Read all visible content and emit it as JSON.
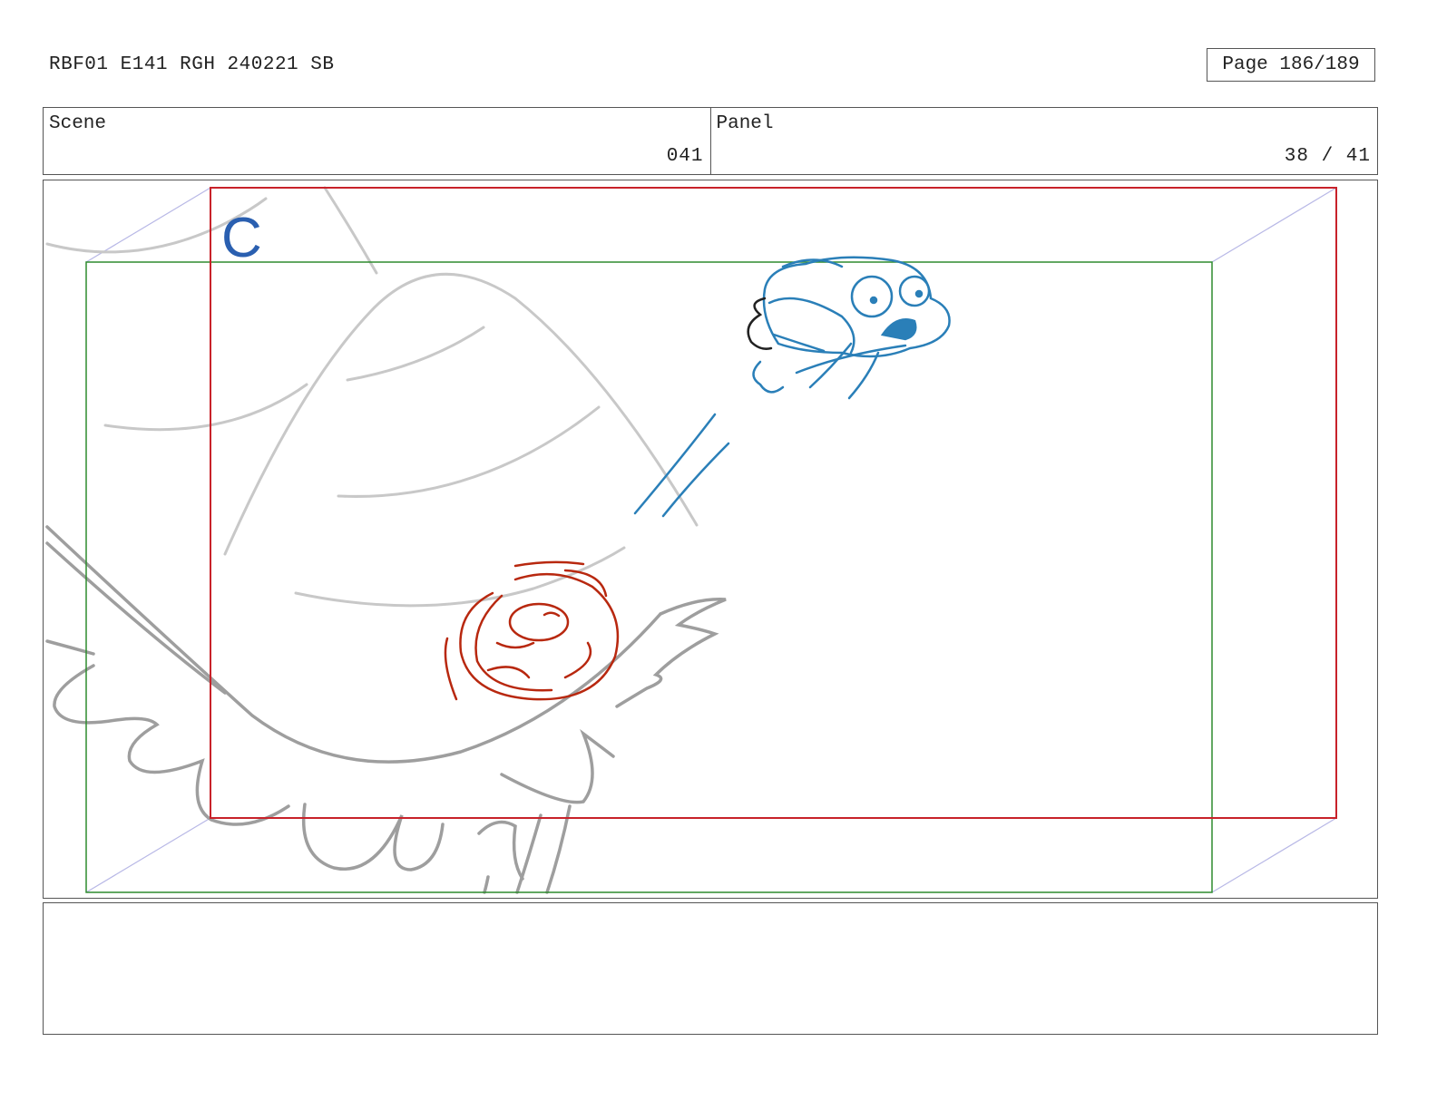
{
  "header": {
    "title": "RBF01 E141 RGH 240221 SB",
    "page": "Page 186/189"
  },
  "info": {
    "scene_label": "Scene",
    "scene_value": "041",
    "panel_label": "Panel",
    "panel_value": "38 / 41"
  },
  "panel": {
    "marker": "C",
    "colors": {
      "action_safe": "#c8222a",
      "title_safe": "#2e8b2e",
      "background_sketch": "#c4c4c4",
      "foreground_sketch": "#9a9a9a",
      "character_blue": "#2a7fb8",
      "character_red": "#b8280f",
      "perspective_lines": "#b8b8e6"
    }
  },
  "notes": {
    "text": ""
  }
}
